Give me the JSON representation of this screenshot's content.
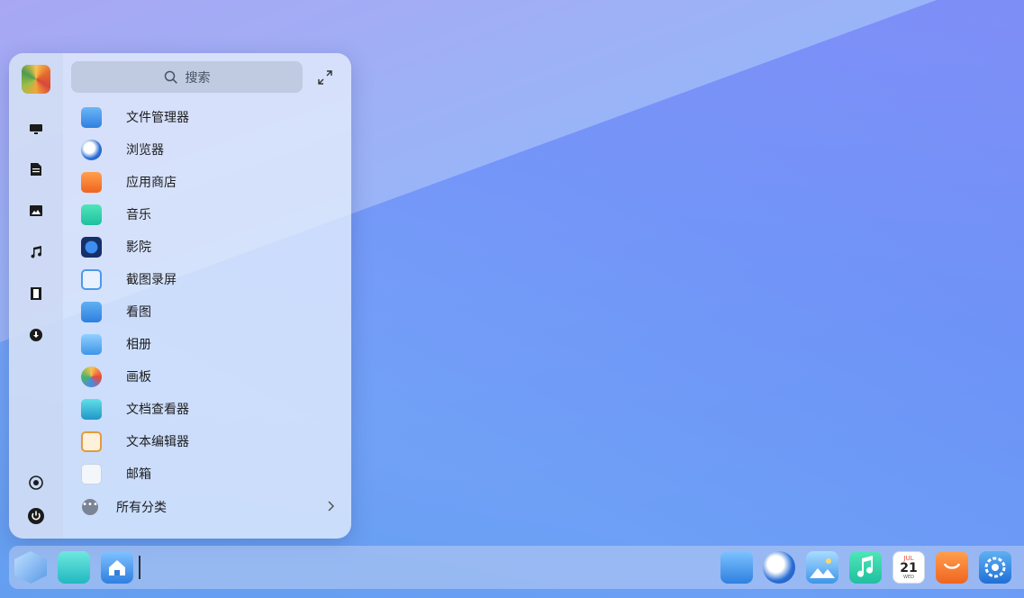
{
  "launcher": {
    "search": {
      "placeholder": "搜索",
      "icon": "search-icon"
    },
    "expand_icon": "expand-icon",
    "sidebar": [
      {
        "name": "desktop",
        "icon": "monitor-icon"
      },
      {
        "name": "documents",
        "icon": "document-icon"
      },
      {
        "name": "pictures",
        "icon": "picture-icon"
      },
      {
        "name": "music",
        "icon": "music-note-icon"
      },
      {
        "name": "videos",
        "icon": "film-icon"
      },
      {
        "name": "downloads",
        "icon": "download-icon"
      },
      {
        "name": "settings",
        "icon": "settings-icon"
      },
      {
        "name": "power",
        "icon": "power-icon"
      }
    ],
    "apps": [
      {
        "label": "文件管理器",
        "icon": "file-manager-icon",
        "color": "#3a8de8"
      },
      {
        "label": "浏览器",
        "icon": "browser-icon",
        "color": "#2a6fd6"
      },
      {
        "label": "应用商店",
        "icon": "app-store-icon",
        "color": "#f5782b"
      },
      {
        "label": "音乐",
        "icon": "music-app-icon",
        "color": "#2fd0a8"
      },
      {
        "label": "影院",
        "icon": "movie-app-icon",
        "color": "#1d3f8f"
      },
      {
        "label": "截图录屏",
        "icon": "screenshot-icon",
        "color": "#4a9ae8"
      },
      {
        "label": "看图",
        "icon": "image-viewer-icon",
        "color": "#3c93e6"
      },
      {
        "label": "相册",
        "icon": "album-icon",
        "color": "#54a9f0"
      },
      {
        "label": "画板",
        "icon": "draw-icon",
        "color": "#e8844a"
      },
      {
        "label": "文档查看器",
        "icon": "document-viewer-icon",
        "color": "#23b3c9"
      },
      {
        "label": "文本编辑器",
        "icon": "text-editor-icon",
        "color": "#e59a3a"
      },
      {
        "label": "邮箱",
        "icon": "mail-icon",
        "color": "#e8eef8"
      }
    ],
    "all_categories": {
      "label": "所有分类",
      "icon": "more-icon",
      "chevron": "chevron-right-icon"
    }
  },
  "dock": {
    "items": [
      {
        "name": "launcher",
        "icon": "launcher-cube-icon",
        "color": "#7fb4ea"
      },
      {
        "name": "multitask",
        "icon": "multitask-icon",
        "color": "#37c9c5"
      },
      {
        "name": "desktop-home",
        "icon": "home-icon",
        "color": "#3d8ae6"
      },
      {
        "name": "file-manager",
        "icon": "file-manager-icon",
        "color": "#3a8de8"
      },
      {
        "name": "browser",
        "icon": "browser-icon",
        "color": "#2a6fd6"
      },
      {
        "name": "album",
        "icon": "album-icon",
        "color": "#54a9f0"
      },
      {
        "name": "music",
        "icon": "music-app-icon",
        "color": "#2fd0a8"
      },
      {
        "name": "calendar",
        "icon": "calendar-icon",
        "color": "#ffffff",
        "month": "JUL",
        "day": "21",
        "weekday": "WED"
      },
      {
        "name": "app-store",
        "icon": "app-store-icon",
        "color": "#f5782b"
      },
      {
        "name": "settings",
        "icon": "settings-icon",
        "color": "#2f8ae6"
      }
    ]
  }
}
